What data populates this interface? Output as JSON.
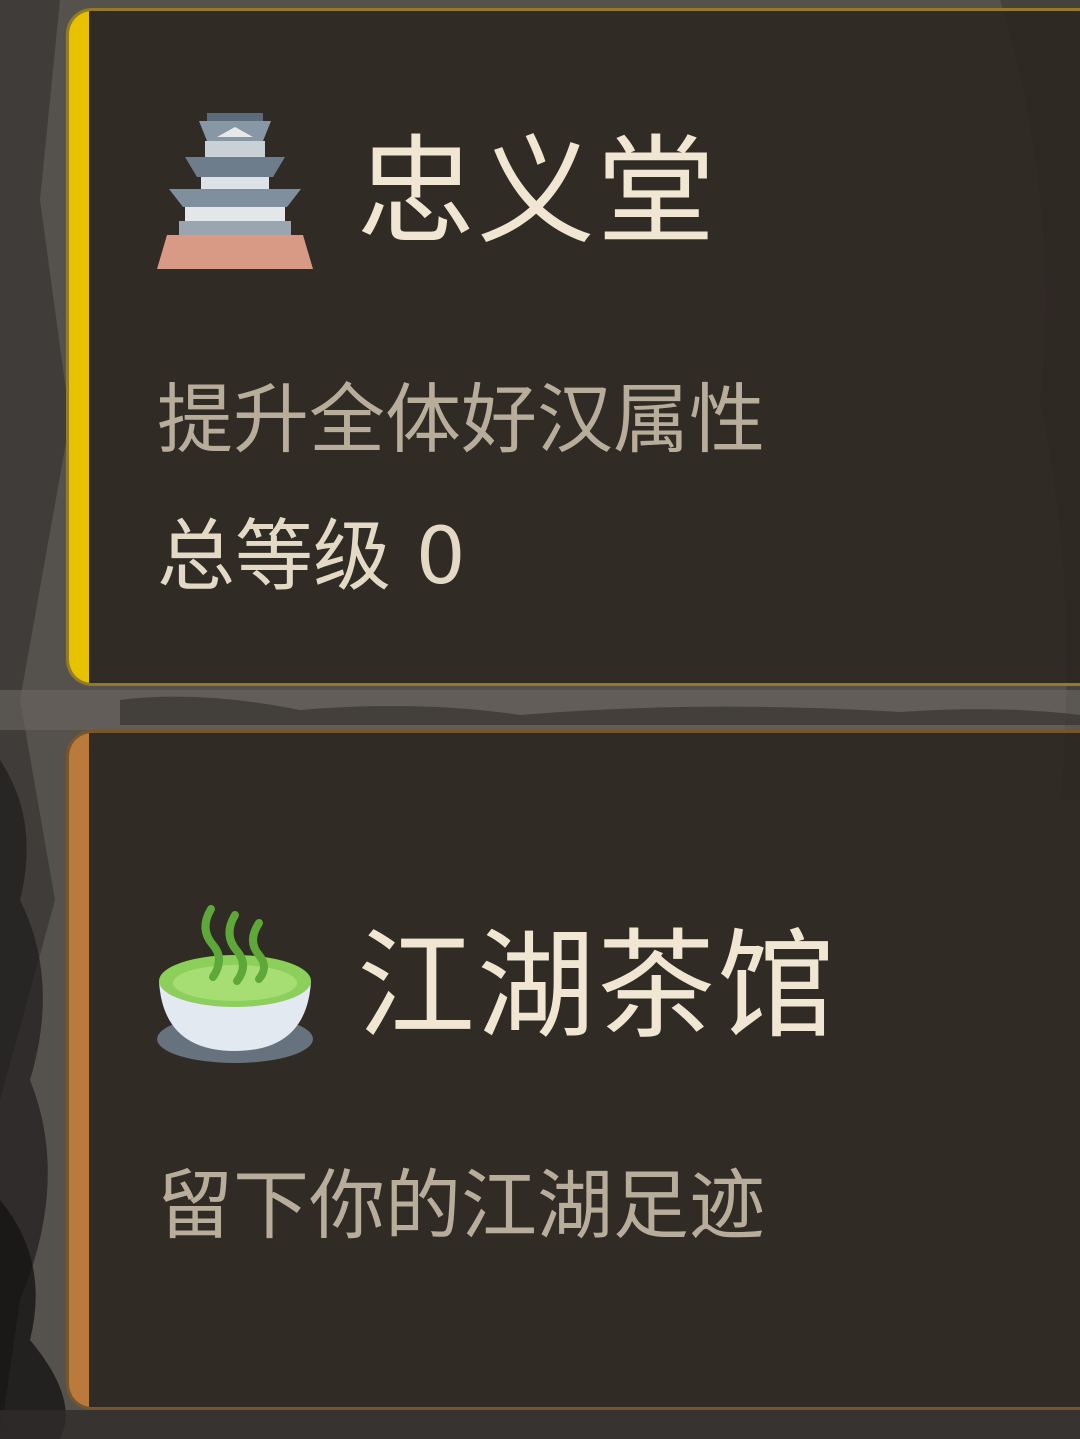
{
  "cards": [
    {
      "icon": "castle-icon",
      "title": "忠义堂",
      "description": "提升全体好汉属性",
      "level_label": "总等级",
      "level_value": "0",
      "accent_color": "#e6c200"
    },
    {
      "icon": "tea-bowl-icon",
      "title": "江湖茶馆",
      "description": "留下你的江湖足迹",
      "accent_color": "#b97a3b"
    }
  ]
}
